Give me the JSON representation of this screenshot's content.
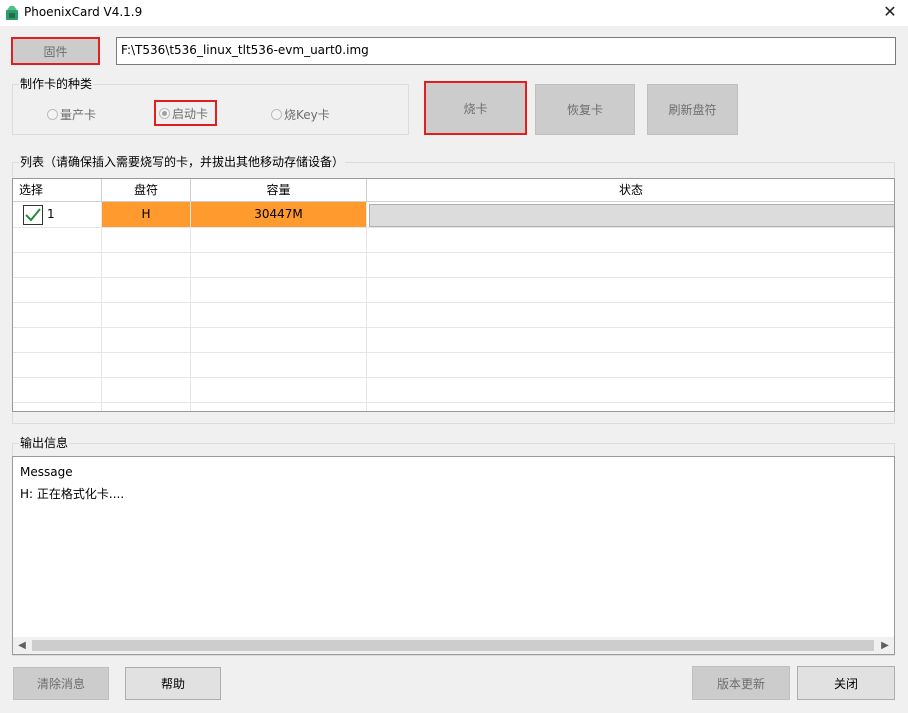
{
  "window": {
    "title": "PhoenixCard V4.1.9",
    "close_glyph": "✕"
  },
  "firmware": {
    "button_label": "固件",
    "path": "F:\\T536\\t536_linux_tlt536-evm_uart0.img"
  },
  "card_type": {
    "label": "制作卡的种类",
    "options": [
      {
        "label": "量产卡",
        "checked": false
      },
      {
        "label": "启动卡",
        "checked": true
      },
      {
        "label": "烧Key卡",
        "checked": false
      }
    ]
  },
  "actions": {
    "burn": "烧卡",
    "restore": "恢复卡",
    "refresh": "刷新盘符"
  },
  "list": {
    "label": "列表（请确保插入需要烧写的卡，并拔出其他移动存储设备）",
    "columns": [
      "选择",
      "盘符",
      "容量",
      "状态"
    ],
    "rows": [
      {
        "index": "1",
        "selected": true,
        "drive": "H",
        "capacity": "30447M",
        "status": ""
      }
    ]
  },
  "output": {
    "label": "输出信息",
    "lines": [
      "Message",
      "H: 正在格式化卡...."
    ]
  },
  "bottom": {
    "clear": "清除消息",
    "help": "帮助",
    "update": "版本更新",
    "close": "关闭"
  },
  "colors": {
    "row_highlight": "#ff9a2e",
    "highlight_border": "#e02020"
  }
}
